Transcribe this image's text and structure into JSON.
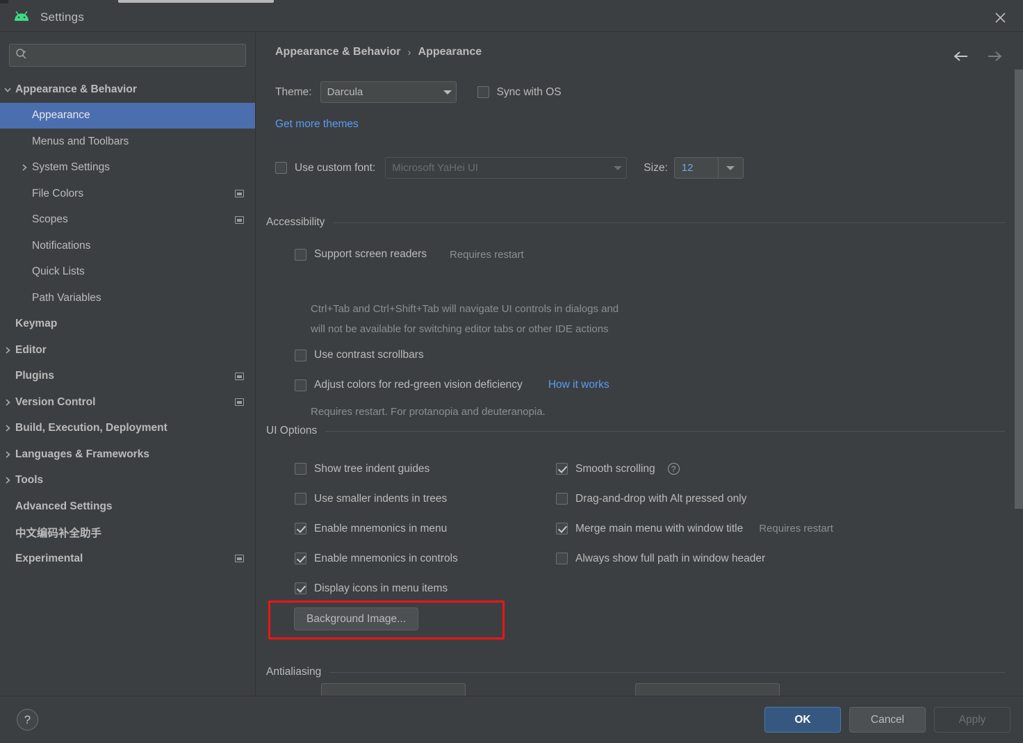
{
  "window": {
    "title": "Settings",
    "logo_icon": "android-logo-icon",
    "close_icon": "close-icon"
  },
  "sidebar": {
    "search": {
      "placeholder": "",
      "value": "",
      "icon": "search-icon"
    },
    "items": [
      {
        "label": "Appearance & Behavior",
        "arrow": "expanded",
        "bold": true,
        "indent": 0,
        "selected": false,
        "badge": false
      },
      {
        "label": "Appearance",
        "arrow": "none",
        "bold": false,
        "indent": 1,
        "selected": true,
        "badge": false
      },
      {
        "label": "Menus and Toolbars",
        "arrow": "none",
        "bold": false,
        "indent": 1,
        "selected": false,
        "badge": false
      },
      {
        "label": "System Settings",
        "arrow": "collapsed",
        "bold": false,
        "indent": 1,
        "selected": false,
        "badge": false
      },
      {
        "label": "File Colors",
        "arrow": "none",
        "bold": false,
        "indent": 1,
        "selected": false,
        "badge": true
      },
      {
        "label": "Scopes",
        "arrow": "none",
        "bold": false,
        "indent": 1,
        "selected": false,
        "badge": true
      },
      {
        "label": "Notifications",
        "arrow": "none",
        "bold": false,
        "indent": 1,
        "selected": false,
        "badge": false
      },
      {
        "label": "Quick Lists",
        "arrow": "none",
        "bold": false,
        "indent": 1,
        "selected": false,
        "badge": false
      },
      {
        "label": "Path Variables",
        "arrow": "none",
        "bold": false,
        "indent": 1,
        "selected": false,
        "badge": false
      },
      {
        "label": "Keymap",
        "arrow": "none",
        "bold": true,
        "indent": 0,
        "selected": false,
        "badge": false
      },
      {
        "label": "Editor",
        "arrow": "collapsed",
        "bold": true,
        "indent": 0,
        "selected": false,
        "badge": false
      },
      {
        "label": "Plugins",
        "arrow": "none",
        "bold": true,
        "indent": 0,
        "selected": false,
        "badge": true
      },
      {
        "label": "Version Control",
        "arrow": "collapsed",
        "bold": true,
        "indent": 0,
        "selected": false,
        "badge": true
      },
      {
        "label": "Build, Execution, Deployment",
        "arrow": "collapsed",
        "bold": true,
        "indent": 0,
        "selected": false,
        "badge": false
      },
      {
        "label": "Languages & Frameworks",
        "arrow": "collapsed",
        "bold": true,
        "indent": 0,
        "selected": false,
        "badge": false
      },
      {
        "label": "Tools",
        "arrow": "collapsed",
        "bold": true,
        "indent": 0,
        "selected": false,
        "badge": false
      },
      {
        "label": "Advanced Settings",
        "arrow": "none",
        "bold": true,
        "indent": 0,
        "selected": false,
        "badge": false
      },
      {
        "label": "中文编码补全助手",
        "arrow": "none",
        "bold": true,
        "indent": 0,
        "selected": false,
        "badge": false
      },
      {
        "label": "Experimental",
        "arrow": "none",
        "bold": true,
        "indent": 0,
        "selected": false,
        "badge": true
      }
    ]
  },
  "main": {
    "breadcrumb": {
      "parent": "Appearance & Behavior",
      "separator": "›",
      "current": "Appearance"
    },
    "nav": {
      "back_icon": "arrow-left-icon",
      "forward_icon": "arrow-right-icon"
    },
    "theme": {
      "label": "Theme:",
      "value": "Darcula",
      "sync_with_os_label": "Sync with OS",
      "sync_with_os_checked": false,
      "get_more_themes": "Get more themes"
    },
    "font": {
      "use_custom_font_label": "Use custom font:",
      "use_custom_font_checked": false,
      "font_value": "Microsoft YaHei UI",
      "size_label": "Size:",
      "size_value": "12"
    },
    "accessibility": {
      "title": "Accessibility",
      "support_screen_readers": {
        "label": "Support screen readers",
        "checked": false,
        "note": "Requires restart"
      },
      "screen_readers_desc_1": "Ctrl+Tab and Ctrl+Shift+Tab will navigate UI controls in dialogs and",
      "screen_readers_desc_2": "will not be available for switching editor tabs or other IDE actions",
      "contrast_scrollbars": {
        "label": "Use contrast scrollbars",
        "checked": false
      },
      "adjust_colors": {
        "label": "Adjust colors for red-green vision deficiency",
        "checked": false,
        "link": "How it works"
      },
      "adjust_colors_desc": "Requires restart. For protanopia and deuteranopia."
    },
    "ui_options": {
      "title": "UI Options",
      "left": [
        {
          "label": "Show tree indent guides",
          "checked": false
        },
        {
          "label": "Use smaller indents in trees",
          "checked": false
        },
        {
          "label": "Enable mnemonics in menu",
          "checked": true
        },
        {
          "label": "Enable mnemonics in controls",
          "checked": true
        },
        {
          "label": "Display icons in menu items",
          "checked": true
        }
      ],
      "right": [
        {
          "label": "Smooth scrolling",
          "checked": true,
          "help": true,
          "note": ""
        },
        {
          "label": "Drag-and-drop with Alt pressed only",
          "checked": false,
          "help": false,
          "note": ""
        },
        {
          "label": "Merge main menu with window title",
          "checked": true,
          "help": false,
          "note": "Requires restart"
        },
        {
          "label": "Always show full path in window header",
          "checked": false,
          "help": false,
          "note": ""
        }
      ],
      "background_image_button": "Background Image..."
    },
    "antialiasing": {
      "title": "Antialiasing"
    }
  },
  "footer": {
    "help_icon": "question-mark-icon",
    "ok": "OK",
    "cancel": "Cancel",
    "apply": "Apply"
  },
  "colors": {
    "accent_blue": "#4b6eaf",
    "link_blue": "#589df6",
    "primary_button": "#365880",
    "highlight_red": "#f11414",
    "panel_bg": "#3c3f41",
    "android_green": "#3ddc84"
  }
}
